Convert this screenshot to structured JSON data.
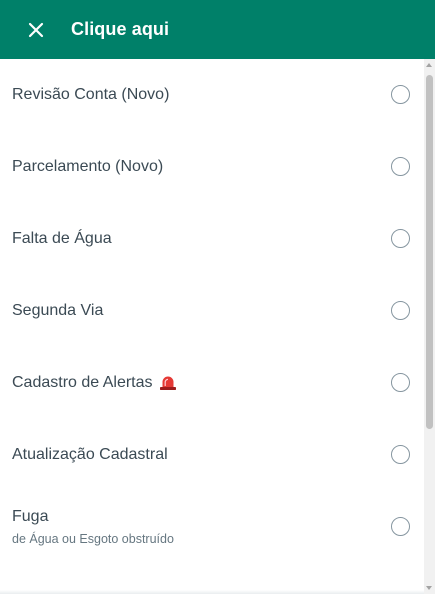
{
  "header": {
    "title": "Clique aqui",
    "close_icon": "close-icon",
    "background": "#008069"
  },
  "options": [
    {
      "label": "Revisão Conta (Novo)"
    },
    {
      "label": "Parcelamento (Novo)"
    },
    {
      "label": "Falta de Água"
    },
    {
      "label": "Segunda Via"
    },
    {
      "label": "Cadastro de Alertas",
      "icon": "siren-icon"
    },
    {
      "label": "Atualização Cadastral"
    },
    {
      "label": "Fuga",
      "sublabel": "de Água ou Esgoto obstruído"
    }
  ]
}
